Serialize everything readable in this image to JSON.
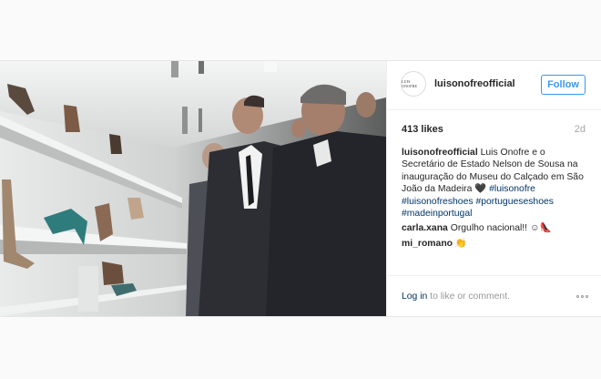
{
  "post": {
    "username": "luisonofreofficial",
    "avatar_icon": "brand-logo-icon",
    "follow_label": "Follow",
    "likes": "413 likes",
    "age": "2d",
    "caption": {
      "author": "luisonofreofficial",
      "text": "Luis Onofre e o Secretário de Estado Nelson de Sousa na inauguração do Museu do Calçado em São João da Madeira 🖤",
      "hashtags": [
        "#luisonofre",
        "#luisonofreshoes",
        "#portugueseshoes",
        "#madeinportugal"
      ]
    },
    "comments": [
      {
        "author": "carla.xana",
        "text": "Orgulho nacional!! ☺👠"
      },
      {
        "author": "mi_romano",
        "text": "👏"
      }
    ],
    "footer": {
      "login_link": "Log in",
      "login_rest": " to like or comment.",
      "more_icon": "more-options-icon"
    },
    "colors": {
      "accent": "#3897f0",
      "link": "#003569",
      "muted": "#999999"
    }
  }
}
